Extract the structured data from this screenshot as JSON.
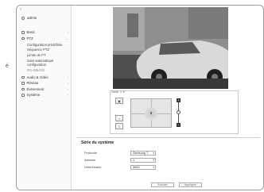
{
  "side_glyph": "é",
  "nav": {
    "back_icon": "chevron-left-icon",
    "user": "admin",
    "items": [
      {
        "label": "Basic",
        "icon": "basic-icon"
      },
      {
        "label": "PTZ",
        "icon": "ptz-icon"
      }
    ],
    "ptz_sub": [
      "Configuration prédéfinie",
      "Séquence PTZ",
      "Limite de PT",
      "Suivi automatique configuration",
      "RS-485/422"
    ],
    "more_items": [
      {
        "label": "Audio & Vidéo",
        "icon": "audio-video-icon"
      },
      {
        "label": "Réseau",
        "icon": "network-icon"
      },
      {
        "label": "Événement",
        "icon": "event-icon"
      },
      {
        "label": "Système",
        "icon": "system-icon"
      }
    ]
  },
  "ptz_panel": {
    "label": "Zoom",
    "mode": "1"
  },
  "serial": {
    "title": "Série du système",
    "protocol_label": "Protocole",
    "protocol_value": "Samsung T",
    "address_label": "Adresse",
    "address_value": "1",
    "baud_label": "Débit binaire",
    "baud_value": "9600"
  },
  "buttons": {
    "cancel": "Annuler",
    "apply": "Appliquer"
  }
}
